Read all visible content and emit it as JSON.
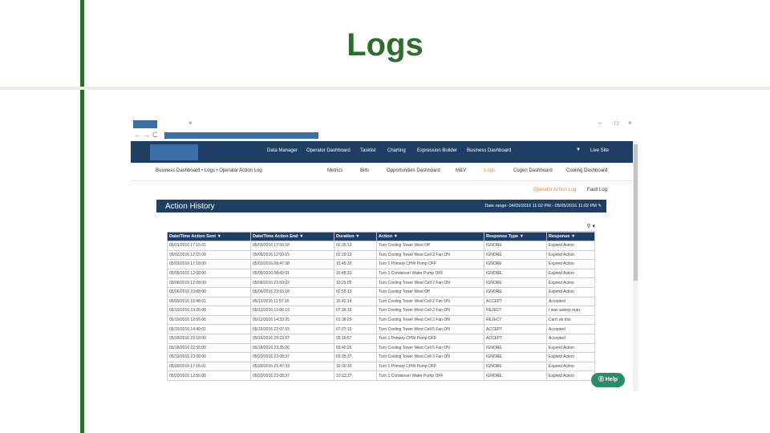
{
  "slide": {
    "title": "Logs"
  },
  "browser": {
    "tab_close": "×",
    "win_min": "–",
    "win_max": "□",
    "win_close": "×",
    "back": "←",
    "forward": "→",
    "reload": "C"
  },
  "appbar": {
    "menu": [
      "Data Manager",
      "Operator Dashboard",
      "Tasklist",
      "Charting",
      "Expression Builder",
      "Business Dashboard"
    ],
    "caret": "▼",
    "live_site": "Live Site"
  },
  "subnav": {
    "breadcrumb": "Business Dashboard • Logs • Operator Action Log",
    "tabs": [
      "Metrics",
      "Bills",
      "Opportunities Dashboard",
      "M&V",
      "Logs",
      "Cogen Dashboard",
      "Cooling Dashboard"
    ],
    "active_tab": "Logs"
  },
  "links": {
    "action_log": "Operator Action Log",
    "fault_log": "Fault Log"
  },
  "panel": {
    "title": "Action History",
    "date_range": "Date range: 04/05/2016 11:02 PM - 05/05/2016 11:02 PM ✎"
  },
  "search": {
    "icon": "⚲ ▾"
  },
  "table": {
    "columns": [
      "Date/Time Action Sent ▼",
      "Date/Time Action End ▼",
      "Duration ▼",
      "Action ▼",
      "Response Type ▼",
      "Response ▼"
    ],
    "rows": [
      [
        "05/01/2016 17:15:01",
        "05/03/2016 17:50:18",
        "02:35:13",
        "Turn Cooling Tower West Off",
        "IGNORE",
        "Expired Action"
      ],
      [
        "05/02/2016 12:15:00",
        "05/05/2016 12:00:15",
        "02:20:13",
        "Turn Cooling Tower West Cell 2 Fan ON",
        "IGNORE",
        "Expired Action"
      ],
      [
        "05/03/2016 17:18:00",
        "05/03/2016 08:47:38",
        "15:45:33",
        "Turn 1 Primary CHW Pump OFF",
        "IGNORE",
        "Expired Action"
      ],
      [
        "05/05/2016 12:08:00",
        "05/05/2016 08:43:01",
        "15:45:31",
        "Turn 1 Condenser Water Pump OFF",
        "IGNORE",
        "Expired Action"
      ],
      [
        "05/06/2016 12:08:00",
        "05/06/2016 23:50:02",
        "10:25:02",
        "Turn Cooling Tower West Cell 2 Fan ON",
        "IGNORE",
        "Expired Action"
      ],
      [
        "05/06/2016 23:08:00",
        "05/06/2016 23:53:18",
        "02:55:13",
        "Turn Cooling Tower West Off",
        "IGNORE",
        "Expired Action"
      ],
      [
        "05/09/2016 15:48:01",
        "05/12/2016 11:57:15",
        "15:42:14",
        "Turn Cooling Tower West Cell 2 Fan ON",
        "ACCEPT",
        "Accepted"
      ],
      [
        "05/10/2016 13:26:00",
        "05/12/2016 13:06:19",
        "07:36:19",
        "Turn Cooling Tower West Cell 2 Fan ON",
        "REJECT",
        "I was asleep man"
      ],
      [
        "05/10/2016 12:55:00",
        "05/12/2016 14:33:25",
        "01:38:25",
        "Turn Cooling Tower West Cell 2 Fan ON",
        "REJECT",
        "Can't do this"
      ],
      [
        "05/15/2016 14:40:01",
        "05/15/2016 22:07:15",
        "07:27:15",
        "Turn Cooling Tower West Cell 5 Fan ON",
        "ACCEPT",
        "Accepted"
      ],
      [
        "05/18/2016 23:18:00",
        "05/16/2016 23:23:57",
        "05:16:57",
        "Turn 1 Primary CHW Pump OFF",
        "ACCEPT",
        "Accepted"
      ],
      [
        "05/18/2016 22:55:00",
        "05/18/2016 23:35:26",
        "02:40:26",
        "Turn Cooling Tower West Cell 5 Fan ON",
        "IGNORE",
        "Expired Action"
      ],
      [
        "05/19/2016 23:08:00",
        "05/20/2016 23:08:37",
        "02:25:37",
        "Turn Cooling Tower West Cell 3 Fan ON",
        "IGNORE",
        "Expired Action"
      ],
      [
        "05/20/2016 17:15:01",
        "05/20/2016 21:47:33",
        "10:30:33",
        "Turn 1 Primary CHW Pump OFF",
        "IGNORE",
        "Expired Action"
      ],
      [
        "05/20/2016 12:55:00",
        "05/20/2016 23:08:37",
        "10:13:37",
        "Turn 1 Condenser Water Pump OFF",
        "IGNORE",
        "Expired Action"
      ]
    ]
  },
  "help": {
    "label": "⓪ Help"
  },
  "colors": {
    "slide_green": "#2f6d2f",
    "nav_blue": "#1e3f63",
    "accent_orange": "#e8821f",
    "help_green": "#2d8a6a"
  }
}
